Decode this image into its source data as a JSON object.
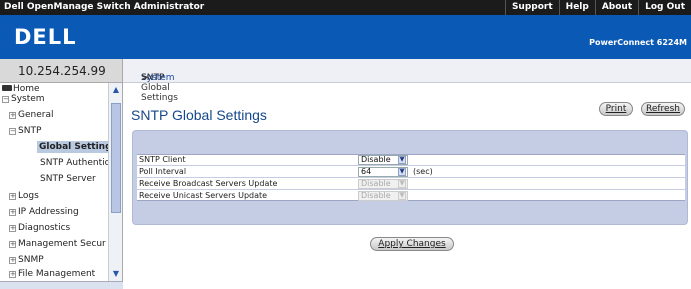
{
  "app": {
    "title": "Dell OpenManage Switch Administrator"
  },
  "top_links": [
    "Support",
    "Help",
    "About",
    "Log Out"
  ],
  "header": {
    "logo": "DELL",
    "model": "PowerConnect 6224M"
  },
  "left": {
    "ip": "10.254.254.99",
    "tree": [
      {
        "label": "Home",
        "icon": "home-icon",
        "expander": ""
      },
      {
        "label": "System",
        "icon": "",
        "expander": "−"
      },
      {
        "label": "General",
        "icon": "",
        "expander": "+"
      },
      {
        "label": "SNTP",
        "icon": "",
        "expander": "−"
      },
      {
        "label": "Global Settings",
        "icon": "",
        "expander": "",
        "selected": true
      },
      {
        "label": "SNTP Authentic:",
        "icon": "",
        "expander": ""
      },
      {
        "label": "SNTP Server",
        "icon": "",
        "expander": ""
      },
      {
        "label": "Logs",
        "icon": "",
        "expander": "+"
      },
      {
        "label": "IP Addressing",
        "icon": "",
        "expander": "+"
      },
      {
        "label": "Diagnostics",
        "icon": "",
        "expander": "+"
      },
      {
        "label": "Management Secur",
        "icon": "",
        "expander": "+"
      },
      {
        "label": "SNMP",
        "icon": "",
        "expander": "+"
      },
      {
        "label": "File Management",
        "icon": "",
        "expander": "+"
      }
    ]
  },
  "breadcrumb": {
    "system": "System",
    "sep1": " > ",
    "sntp": "SNTP",
    "sep2": " > ",
    "current": "SNTP Global Settings"
  },
  "main": {
    "title": "SNTP Global Settings",
    "print_label": "Print",
    "refresh_label": "Refresh",
    "apply_label": "Apply Changes",
    "fields": [
      {
        "label": "SNTP Client",
        "value": "Disable",
        "unit": "",
        "disabled": false
      },
      {
        "label": "Poll Interval",
        "value": "64",
        "unit": "(sec)",
        "disabled": false
      },
      {
        "label": "Receive Broadcast Servers Update",
        "value": "Disable",
        "unit": "",
        "disabled": true
      },
      {
        "label": "Receive Unicast Servers Update",
        "value": "Disable",
        "unit": "",
        "disabled": true
      }
    ]
  }
}
